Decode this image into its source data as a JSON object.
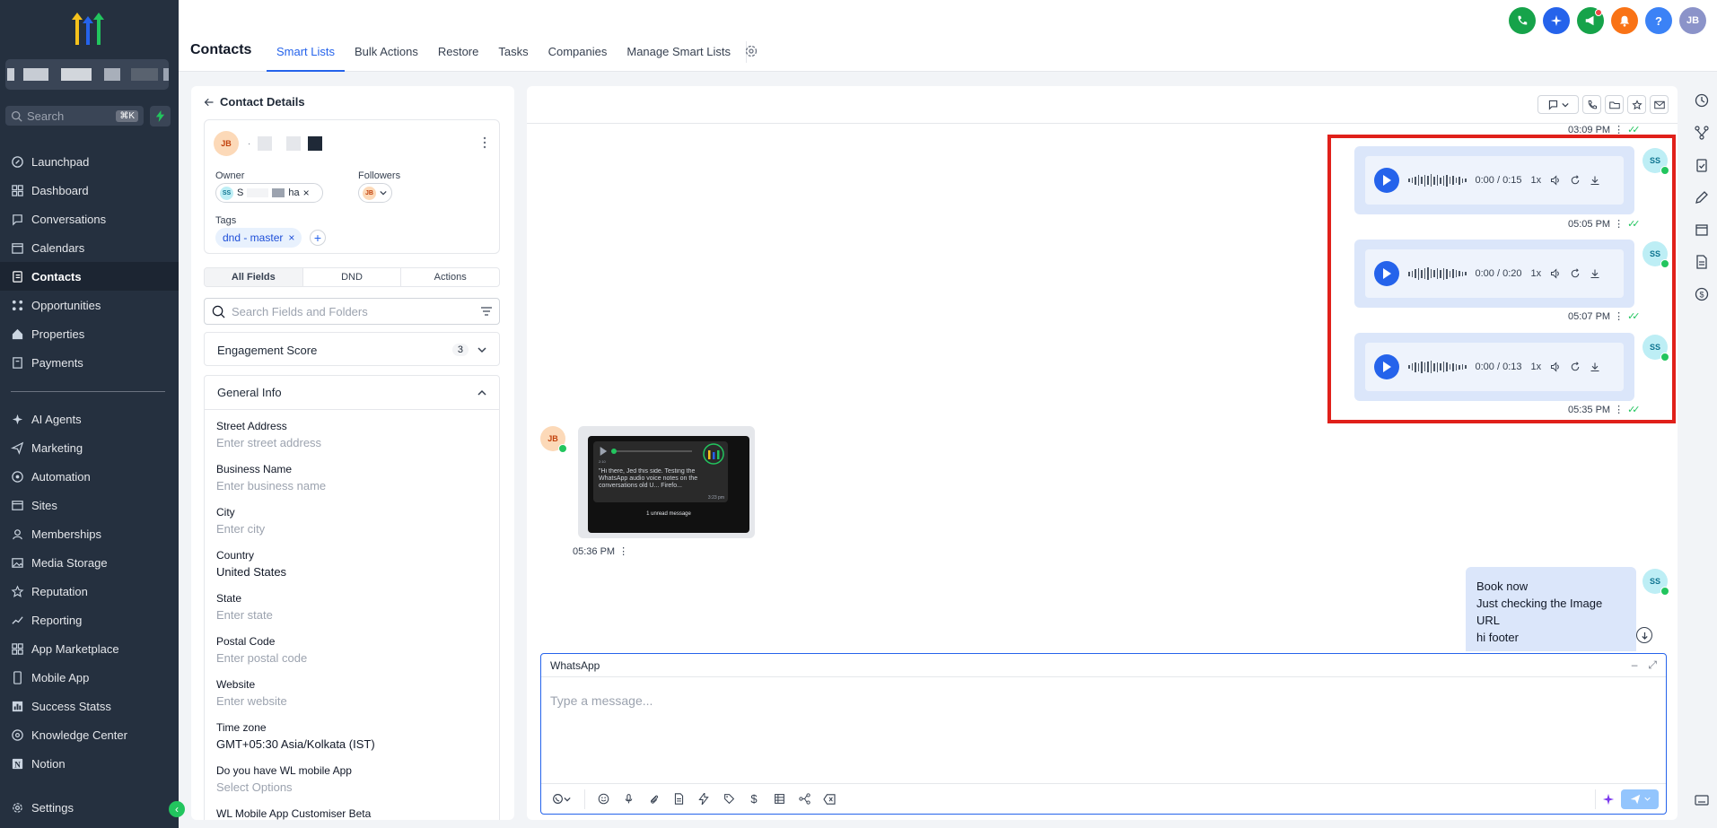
{
  "sidebar": {
    "search_placeholder": "Search",
    "search_shortcut": "⌘K",
    "items": [
      {
        "label": "Launchpad",
        "icon": "launchpad-icon"
      },
      {
        "label": "Dashboard",
        "icon": "dashboard-icon"
      },
      {
        "label": "Conversations",
        "icon": "chat-icon"
      },
      {
        "label": "Calendars",
        "icon": "calendar-icon"
      },
      {
        "label": "Contacts",
        "icon": "contacts-icon",
        "active": true
      },
      {
        "label": "Opportunities",
        "icon": "opportunities-icon"
      },
      {
        "label": "Properties",
        "icon": "home-icon"
      },
      {
        "label": "Payments",
        "icon": "payments-icon"
      }
    ],
    "items2": [
      {
        "label": "AI Agents",
        "icon": "ai-agents-icon"
      },
      {
        "label": "Marketing",
        "icon": "send-icon"
      },
      {
        "label": "Automation",
        "icon": "automation-icon"
      },
      {
        "label": "Sites",
        "icon": "sites-icon"
      },
      {
        "label": "Memberships",
        "icon": "memberships-icon"
      },
      {
        "label": "Media Storage",
        "icon": "image-icon"
      },
      {
        "label": "Reputation",
        "icon": "star-icon"
      },
      {
        "label": "Reporting",
        "icon": "trend-icon"
      },
      {
        "label": "App Marketplace",
        "icon": "grid-icon"
      },
      {
        "label": "Mobile App",
        "icon": "mobile-icon"
      },
      {
        "label": "Success Statss",
        "icon": "chart-icon"
      },
      {
        "label": "Knowledge Center",
        "icon": "knowledge-icon"
      },
      {
        "label": "Notion",
        "icon": "notion-icon"
      }
    ],
    "settings_label": "Settings"
  },
  "header": {
    "title": "Contacts",
    "tabs": [
      "Smart Lists",
      "Bulk Actions",
      "Restore",
      "Tasks",
      "Companies",
      "Manage Smart Lists"
    ],
    "active_tab": "Smart Lists",
    "avatar_initials": "JB"
  },
  "contact": {
    "back_label": "Contact Details",
    "initials": "JB",
    "name_bullet": "·",
    "owner_label": "Owner",
    "owner_initials": "SS",
    "owner_name_start": "S",
    "owner_name_end": "ha",
    "followers_label": "Followers",
    "follower_initials": "JB",
    "tags_label": "Tags",
    "tag": "dnd - master",
    "segments": [
      "All Fields",
      "DND",
      "Actions"
    ],
    "search_placeholder": "Search Fields and Folders",
    "engagement_label": "Engagement Score",
    "engagement_count": "3",
    "general_info_label": "General Info",
    "fields": [
      {
        "label": "Street Address",
        "value": "Enter street address",
        "placeholder": true
      },
      {
        "label": "Business Name",
        "value": "Enter business name",
        "placeholder": true
      },
      {
        "label": "City",
        "value": "Enter city",
        "placeholder": true
      },
      {
        "label": "Country",
        "value": "United States",
        "placeholder": false
      },
      {
        "label": "State",
        "value": "Enter state",
        "placeholder": true
      },
      {
        "label": "Postal Code",
        "value": "Enter postal code",
        "placeholder": true
      },
      {
        "label": "Website",
        "value": "Enter website",
        "placeholder": true
      },
      {
        "label": "Time zone",
        "value": "GMT+05:30 Asia/Kolkata (IST)",
        "placeholder": false
      },
      {
        "label": "Do you have WL mobile App",
        "value": "Select Options",
        "placeholder": true
      },
      {
        "label": "WL Mobile App Customiser Beta",
        "value": "",
        "placeholder": true
      }
    ]
  },
  "chat": {
    "top_time": "03:09 PM",
    "audio_messages": [
      {
        "time": "0:00 / 0:15",
        "speed": "1x",
        "sent": "05:05 PM",
        "avatar": "SS"
      },
      {
        "time": "0:00 / 0:20",
        "speed": "1x",
        "sent": "05:07 PM",
        "avatar": "SS"
      },
      {
        "time": "0:00 / 0:13",
        "speed": "1x",
        "sent": "05:35 PM",
        "avatar": "SS"
      }
    ],
    "image_message": {
      "avatar": "JB",
      "sent": "05:36 PM",
      "caption": "\"Hi there, Jed this side. Testing the WhatsApp audio voice notes on the conversations old U... Firefo...",
      "caption_time": "3:23 pm",
      "audio_time": "2:10",
      "footer": "1 unread message"
    },
    "text_message": {
      "avatar": "SS",
      "lines": [
        "Book now",
        "Just checking the Image URL",
        "hi footer"
      ]
    },
    "composer": {
      "channel": "WhatsApp",
      "placeholder": "Type a message..."
    }
  }
}
